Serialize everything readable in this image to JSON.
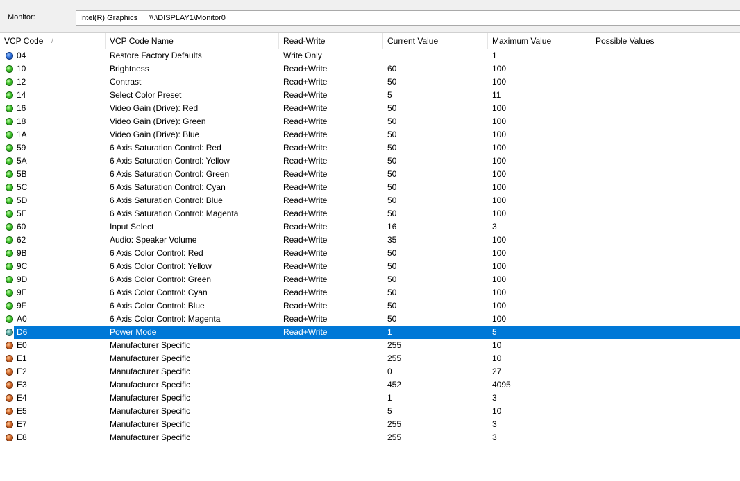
{
  "monitor_bar": {
    "label": "Monitor:",
    "adapter": "Intel(R) Graphics",
    "path": "\\\\.\\DISPLAY1\\Monitor0"
  },
  "columns": {
    "code": "VCP Code",
    "sort_indicator": "/",
    "name": "VCP Code Name",
    "rw": "Read-Write",
    "current": "Current Value",
    "max": "Maximum Value",
    "possible": "Possible Values"
  },
  "status_colors": {
    "blue": "#2f6fd6",
    "green": "#3fc22b",
    "orange": "#d0682a",
    "teal": "#55a8a0",
    "selection": "#0078d7"
  },
  "rows": [
    {
      "code": "04",
      "name": "Restore Factory Defaults",
      "rw": "Write Only",
      "current": "",
      "max": "1",
      "possible": "",
      "status": "blue"
    },
    {
      "code": "10",
      "name": "Brightness",
      "rw": "Read+Write",
      "current": "60",
      "max": "100",
      "possible": "",
      "status": "green"
    },
    {
      "code": "12",
      "name": "Contrast",
      "rw": "Read+Write",
      "current": "50",
      "max": "100",
      "possible": "",
      "status": "green"
    },
    {
      "code": "14",
      "name": "Select Color Preset",
      "rw": "Read+Write",
      "current": "5",
      "max": "11",
      "possible": "",
      "status": "green"
    },
    {
      "code": "16",
      "name": "Video Gain (Drive): Red",
      "rw": "Read+Write",
      "current": "50",
      "max": "100",
      "possible": "",
      "status": "green"
    },
    {
      "code": "18",
      "name": "Video Gain (Drive): Green",
      "rw": "Read+Write",
      "current": "50",
      "max": "100",
      "possible": "",
      "status": "green"
    },
    {
      "code": "1A",
      "name": "Video Gain (Drive): Blue",
      "rw": "Read+Write",
      "current": "50",
      "max": "100",
      "possible": "",
      "status": "green"
    },
    {
      "code": "59",
      "name": "6 Axis Saturation Control: Red",
      "rw": "Read+Write",
      "current": "50",
      "max": "100",
      "possible": "",
      "status": "green"
    },
    {
      "code": "5A",
      "name": "6 Axis Saturation Control: Yellow",
      "rw": "Read+Write",
      "current": "50",
      "max": "100",
      "possible": "",
      "status": "green"
    },
    {
      "code": "5B",
      "name": "6 Axis Saturation Control: Green",
      "rw": "Read+Write",
      "current": "50",
      "max": "100",
      "possible": "",
      "status": "green"
    },
    {
      "code": "5C",
      "name": "6 Axis Saturation Control: Cyan",
      "rw": "Read+Write",
      "current": "50",
      "max": "100",
      "possible": "",
      "status": "green"
    },
    {
      "code": "5D",
      "name": "6 Axis Saturation Control: Blue",
      "rw": "Read+Write",
      "current": "50",
      "max": "100",
      "possible": "",
      "status": "green"
    },
    {
      "code": "5E",
      "name": "6 Axis Saturation Control: Magenta",
      "rw": "Read+Write",
      "current": "50",
      "max": "100",
      "possible": "",
      "status": "green"
    },
    {
      "code": "60",
      "name": "Input Select",
      "rw": "Read+Write",
      "current": "16",
      "max": "3",
      "possible": "",
      "status": "green"
    },
    {
      "code": "62",
      "name": "Audio: Speaker Volume",
      "rw": "Read+Write",
      "current": "35",
      "max": "100",
      "possible": "",
      "status": "green"
    },
    {
      "code": "9B",
      "name": "6 Axis Color Control: Red",
      "rw": "Read+Write",
      "current": "50",
      "max": "100",
      "possible": "",
      "status": "green"
    },
    {
      "code": "9C",
      "name": "6 Axis Color Control: Yellow",
      "rw": "Read+Write",
      "current": "50",
      "max": "100",
      "possible": "",
      "status": "green"
    },
    {
      "code": "9D",
      "name": "6 Axis Color Control: Green",
      "rw": "Read+Write",
      "current": "50",
      "max": "100",
      "possible": "",
      "status": "green"
    },
    {
      "code": "9E",
      "name": "6 Axis Color Control: Cyan",
      "rw": "Read+Write",
      "current": "50",
      "max": "100",
      "possible": "",
      "status": "green"
    },
    {
      "code": "9F",
      "name": "6 Axis Color Control: Blue",
      "rw": "Read+Write",
      "current": "50",
      "max": "100",
      "possible": "",
      "status": "green"
    },
    {
      "code": "A0",
      "name": "6 Axis Color Control: Magenta",
      "rw": "Read+Write",
      "current": "50",
      "max": "100",
      "possible": "",
      "status": "green"
    },
    {
      "code": "D6",
      "name": "Power Mode",
      "rw": "Read+Write",
      "current": "1",
      "max": "5",
      "possible": "",
      "status": "teal",
      "selected": true
    },
    {
      "code": "E0",
      "name": "Manufacturer Specific",
      "rw": "",
      "current": "255",
      "max": "10",
      "possible": "",
      "status": "orange"
    },
    {
      "code": "E1",
      "name": "Manufacturer Specific",
      "rw": "",
      "current": "255",
      "max": "10",
      "possible": "",
      "status": "orange"
    },
    {
      "code": "E2",
      "name": "Manufacturer Specific",
      "rw": "",
      "current": "0",
      "max": "27",
      "possible": "",
      "status": "orange"
    },
    {
      "code": "E3",
      "name": "Manufacturer Specific",
      "rw": "",
      "current": "452",
      "max": "4095",
      "possible": "",
      "status": "orange"
    },
    {
      "code": "E4",
      "name": "Manufacturer Specific",
      "rw": "",
      "current": "1",
      "max": "3",
      "possible": "",
      "status": "orange"
    },
    {
      "code": "E5",
      "name": "Manufacturer Specific",
      "rw": "",
      "current": "5",
      "max": "10",
      "possible": "",
      "status": "orange"
    },
    {
      "code": "E7",
      "name": "Manufacturer Specific",
      "rw": "",
      "current": "255",
      "max": "3",
      "possible": "",
      "status": "orange"
    },
    {
      "code": "E8",
      "name": "Manufacturer Specific",
      "rw": "",
      "current": "255",
      "max": "3",
      "possible": "",
      "status": "orange"
    }
  ]
}
